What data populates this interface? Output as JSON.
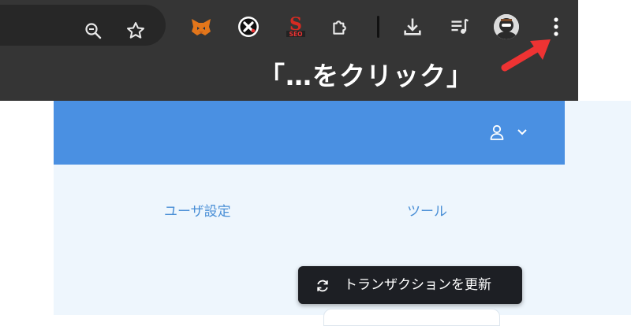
{
  "annotation": {
    "text": "「…をクリック」",
    "arrow_color": "#ee3333"
  },
  "browser_toolbar": {
    "icons": [
      "zoom-icon",
      "bookmark-star-icon",
      "metamask-fox-extension-icon",
      "x-extension-icon",
      "seo-extension-icon",
      "extensions-puzzle-icon",
      "download-icon",
      "media-queue-icon",
      "profile-avatar",
      "kebab-menu-icon"
    ]
  },
  "app": {
    "header": {
      "color": "#4a90e2",
      "icons": [
        "user-icon",
        "chevron-down-icon"
      ]
    },
    "tabs": [
      {
        "label": "ユーザ設定"
      },
      {
        "label": "ツール"
      }
    ],
    "tooltip": {
      "icon": "refresh-icon",
      "label": "トランザクションを更新"
    }
  }
}
